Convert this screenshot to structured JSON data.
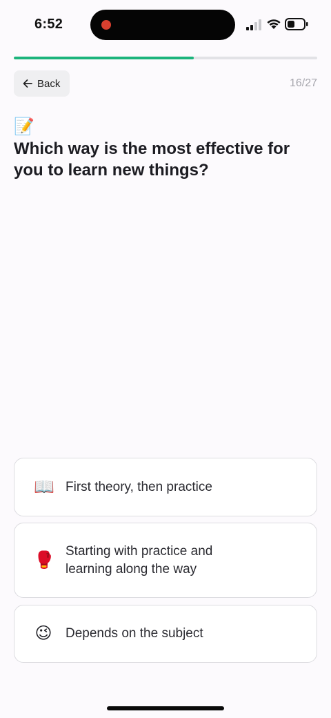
{
  "status_bar": {
    "time": "6:52",
    "icons": [
      "recording-dot-icon",
      "cellular-signal-icon",
      "wifi-icon",
      "battery-icon"
    ]
  },
  "progress": {
    "current": 16,
    "total": 27,
    "fraction": 0.593,
    "color": "#1cb47c"
  },
  "header": {
    "back_label": "Back",
    "counter": "16/27"
  },
  "question": {
    "emoji": "📝",
    "text": "Which way is the most effective for you to learn new things?"
  },
  "options": [
    {
      "icon": "📖",
      "label": "First theory, then practice"
    },
    {
      "icon": "🥊",
      "label": "Starting with practice and learning along the way"
    },
    {
      "icon": "😉",
      "label": "Depends on the subject"
    }
  ]
}
